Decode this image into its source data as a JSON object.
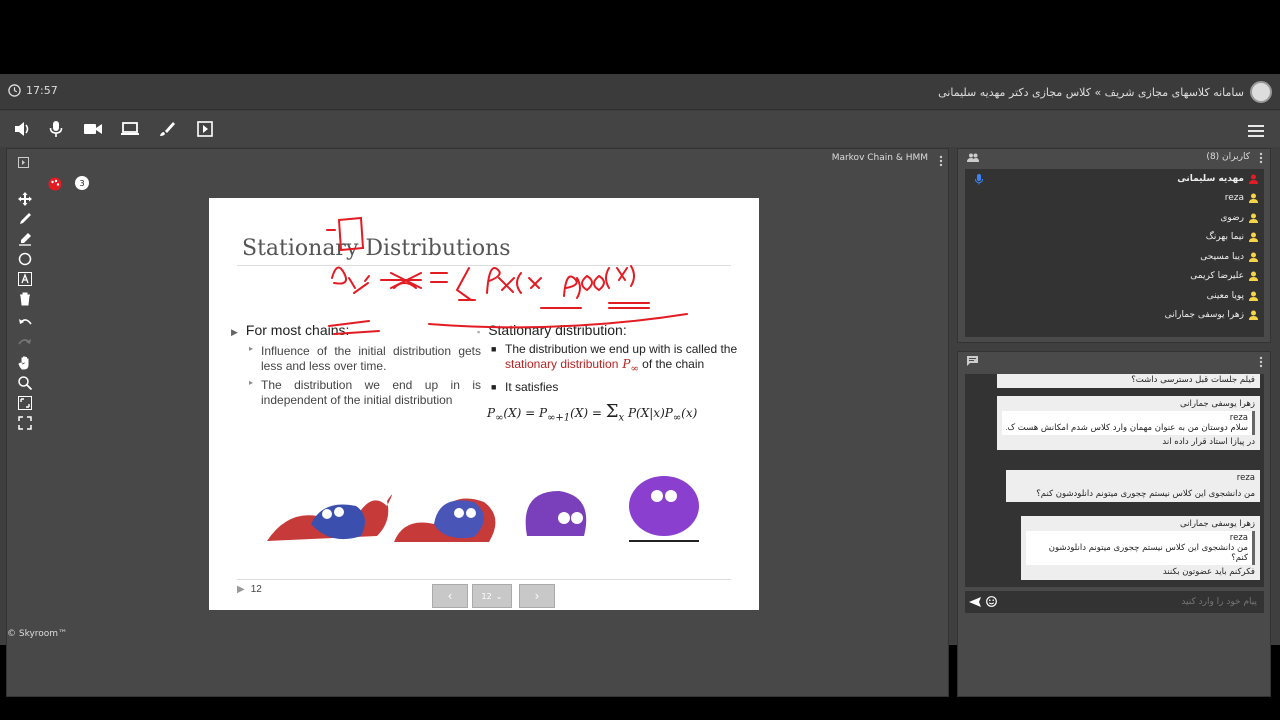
{
  "topbar": {
    "clock": "17:57",
    "breadcrumb": "سامانه کلاسهای مجازی شریف » کلاس مجازی دکتر مهدیه سلیمانی"
  },
  "main": {
    "title": "Markov Chain & HMM",
    "badge": "3"
  },
  "slide": {
    "title": "Stationary Distributions",
    "left_heading": "For most chains:",
    "left_items": [
      "Influence of the initial distribution gets less and less over time.",
      "The distribution we end up in is independent of the initial distribution"
    ],
    "right_heading": "Stationary distribution:",
    "right_item1_a": "The distribution we end up with is called the ",
    "right_item1_red": "stationary distribution",
    "right_item1_b": " of the chain",
    "right_item2": "It satisfies",
    "page_number": "12",
    "nav_page": "12"
  },
  "users": {
    "title": "کاربران (8)",
    "list": [
      "مهدیه سلیمانی",
      "reza",
      "رضوی",
      "نیما بهرنگ",
      "دیبا مسیحی",
      "علیرضا کریمی",
      "پویا معینی",
      "زهرا یوسفی جمارانی"
    ]
  },
  "chat": {
    "m1": "فیلم جلسات قبل دسترسی داشت؟",
    "m2_author": "زهرا یوسفی جمارانی",
    "m2_quote_author": "reza",
    "m2_quote": "سلام دوستان من به عنوان مهمان وارد کلاس شدم امکانش هست ک...",
    "m2_text": "در پیازا استاد قرار داده اند",
    "m3_author": "reza",
    "m3_text": "من دانشجوی این کلاس نیستم چجوری میتونم دانلودشون کنم؟",
    "m4_author": "زهرا یوسفی جمارانی",
    "m4_quote_author": "reza",
    "m4_quote": "من دانشجوی این کلاس نیستم چجوری میتونم دانلودشون کنم؟",
    "m4_text": "فکرکنم باید عضوتون بکنند",
    "input_placeholder": "پیام خود را وارد کنید"
  },
  "footer": "© Skyroom™",
  "colors": {
    "accent_red": "#e31b23",
    "user_yellow": "#f5d547",
    "mic_blue": "#3b82f6",
    "annotation": "#e31b23"
  }
}
